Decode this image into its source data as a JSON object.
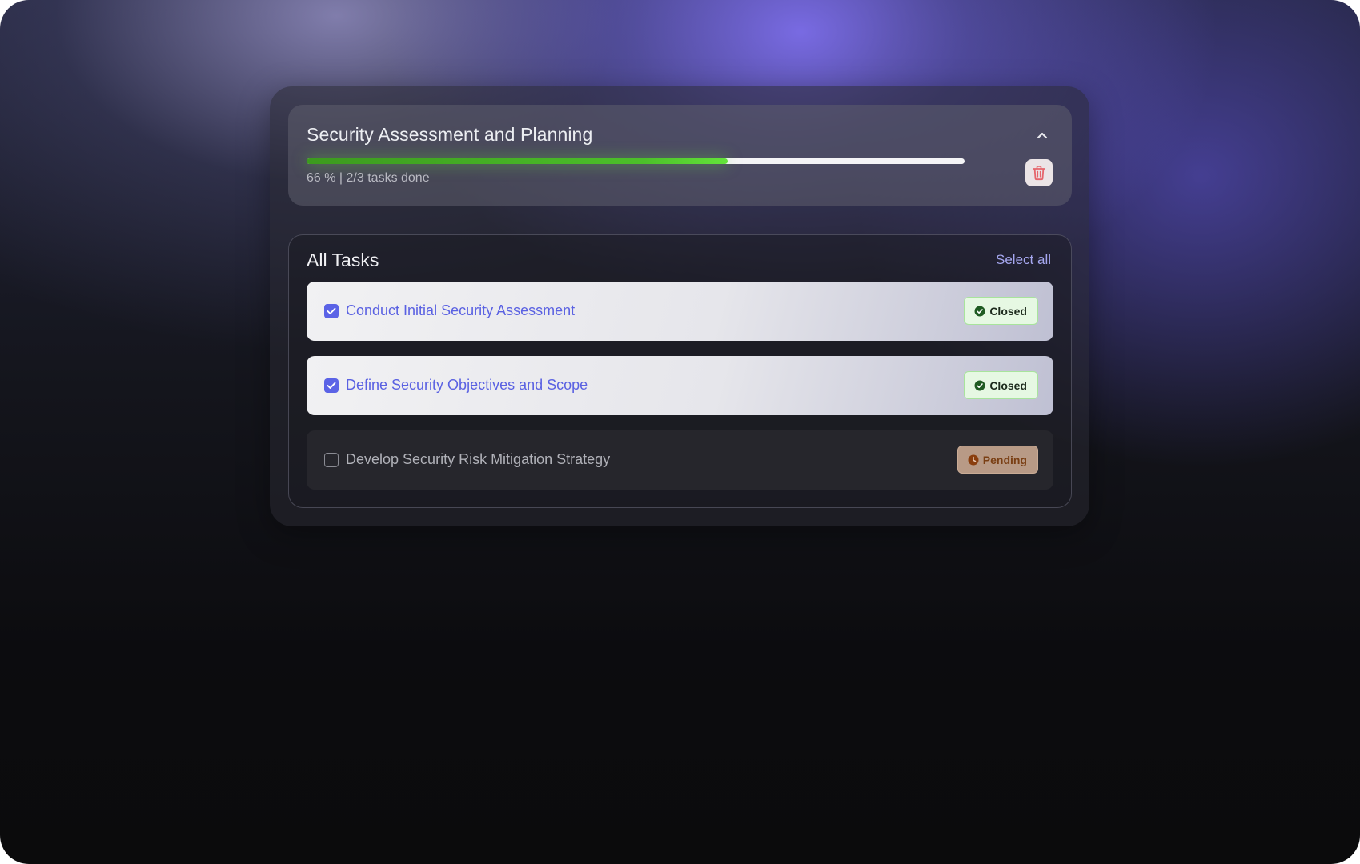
{
  "header": {
    "title": "Security Assessment and Planning",
    "progress_fraction": 0.64,
    "progress_percent_label": "66 % |",
    "tasks_done_label": "2/3 tasks done"
  },
  "tasks_section": {
    "title": "All Tasks",
    "select_all_label": "Select all",
    "items": [
      {
        "label": "Conduct Initial Security Assessment",
        "checked": true,
        "status": "Closed"
      },
      {
        "label": "Define Security Objectives and Scope",
        "checked": true,
        "status": "Closed"
      },
      {
        "label": "Develop Security Risk Mitigation Strategy",
        "checked": false,
        "status": "Pending"
      }
    ]
  },
  "icons": {
    "collapse": "chevron-up-icon",
    "delete": "trash-icon",
    "checked": "checkmark-icon",
    "closed_status": "check-circle-icon",
    "pending_status": "clock-icon"
  },
  "colors": {
    "accent": "#5b63e6",
    "progress": "#4cc02a",
    "closed_badge_bg": "#e6f8e3",
    "pending_badge_bg": "#b89a86",
    "delete_icon": "#e5656c"
  }
}
